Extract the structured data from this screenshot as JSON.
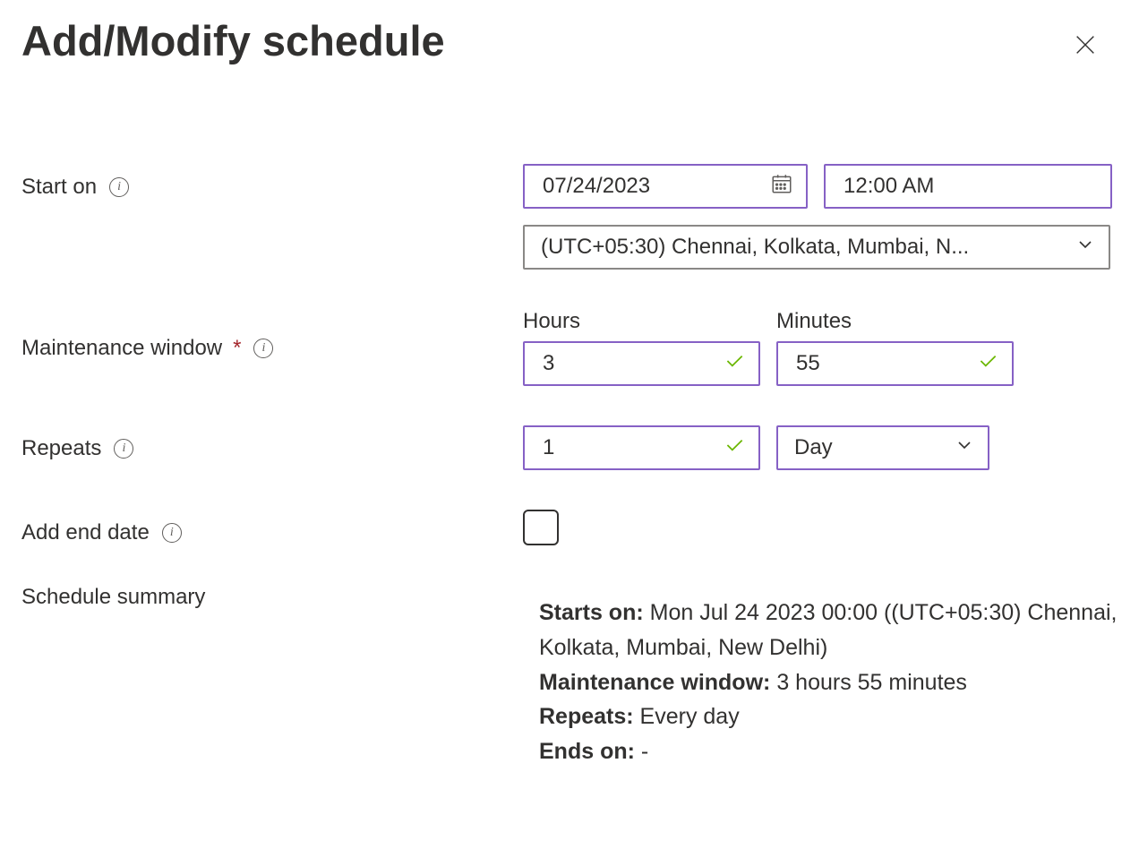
{
  "title": "Add/Modify schedule",
  "labels": {
    "start_on": "Start on",
    "maintenance_window": "Maintenance window",
    "repeats": "Repeats",
    "add_end_date": "Add end date",
    "schedule_summary": "Schedule summary",
    "hours": "Hours",
    "minutes": "Minutes"
  },
  "start": {
    "date": "07/24/2023",
    "time": "12:00 AM",
    "timezone": "(UTC+05:30) Chennai, Kolkata, Mumbai, N..."
  },
  "maintenance": {
    "hours": "3",
    "minutes": "55"
  },
  "repeats": {
    "count": "1",
    "unit": "Day"
  },
  "end_date_checked": false,
  "summary": {
    "starts_on_label": "Starts on:",
    "starts_on_value": "Mon Jul 24 2023 00:00 ((UTC+05:30) Chennai, Kolkata, Mumbai, New Delhi)",
    "maintenance_window_label": "Maintenance window:",
    "maintenance_window_value": "3 hours 55 minutes",
    "repeats_label": "Repeats:",
    "repeats_value": "Every day",
    "ends_on_label": "Ends on:",
    "ends_on_value": "-"
  }
}
